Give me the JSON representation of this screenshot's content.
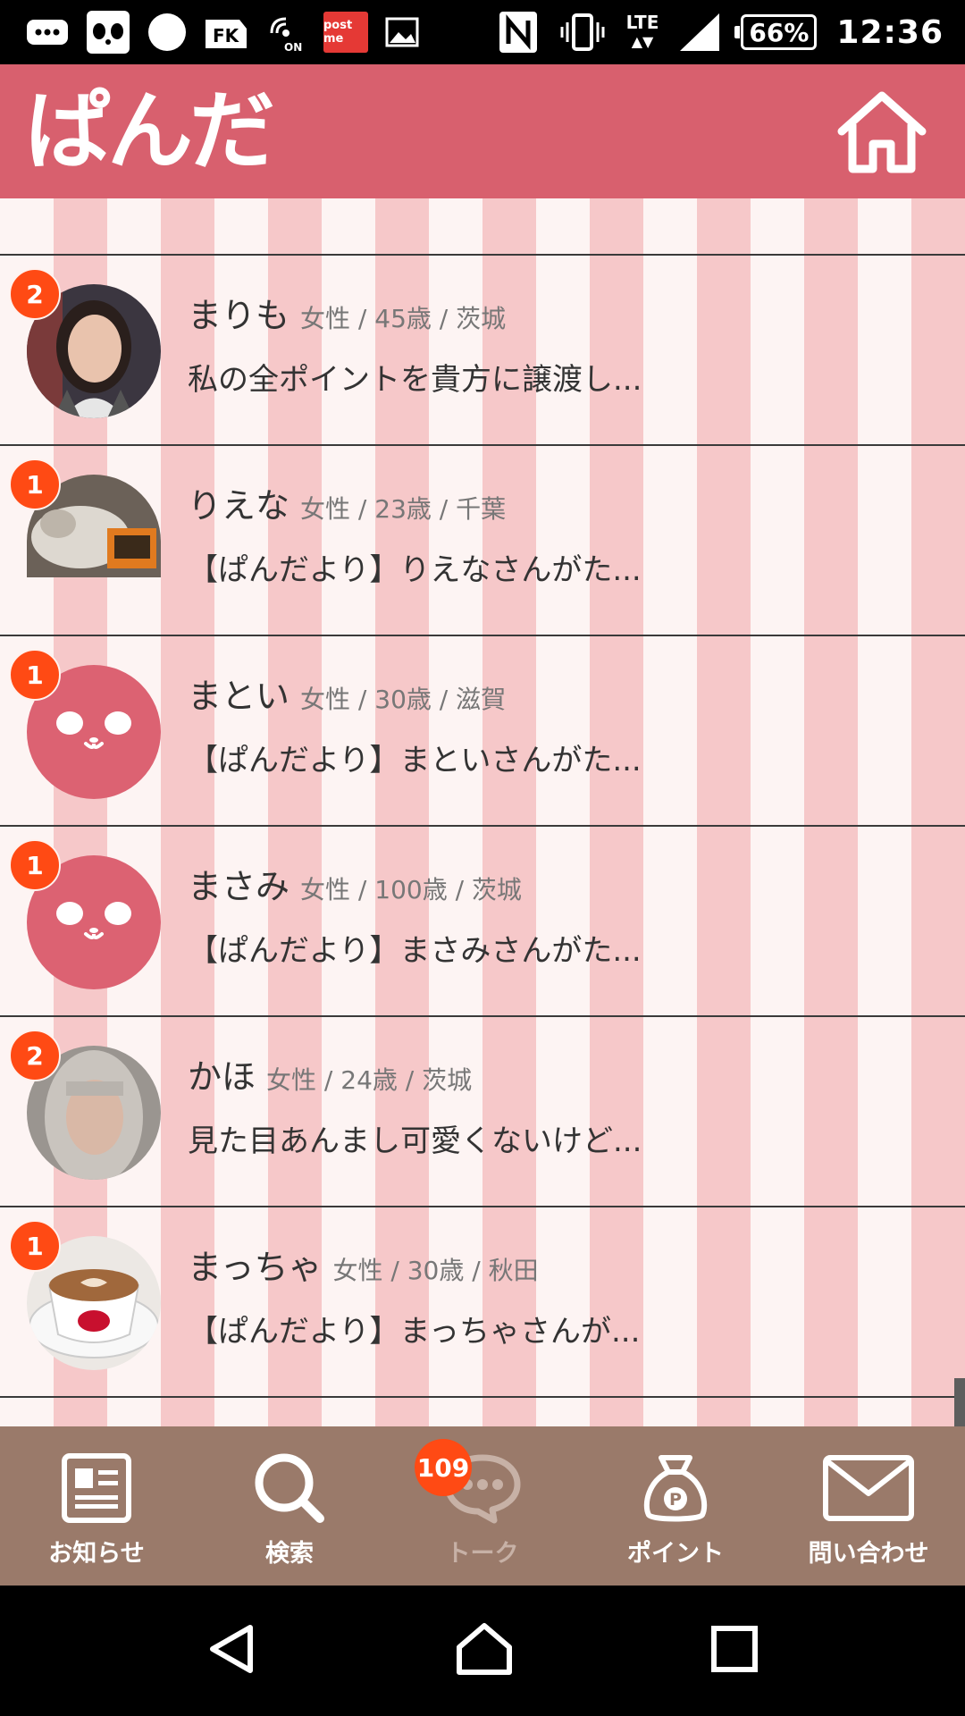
{
  "status_bar": {
    "postme_label": "post me",
    "network": "LTE",
    "battery": "66%",
    "time": "12:36"
  },
  "header": {
    "logo": "ぱんだ",
    "home_icon": "home-icon"
  },
  "messages": [
    {
      "badge": "2",
      "name": "まりも",
      "meta": "女性 / 45歳 / 茨城",
      "preview": "私の全ポイントを貴方に譲渡し...",
      "avatar": "photo-woman"
    },
    {
      "badge": "1",
      "name": "りえな",
      "meta": "女性 / 23歳 / 千葉",
      "preview": "【ぱんだより】りえなさんがた...",
      "avatar": "photo-cat"
    },
    {
      "badge": "1",
      "name": "まとい",
      "meta": "女性 / 30歳 / 滋賀",
      "preview": "【ぱんだより】まといさんがた...",
      "avatar": "panda"
    },
    {
      "badge": "1",
      "name": "まさみ",
      "meta": "女性 / 100歳 / 茨城",
      "preview": "【ぱんだより】まさみさんがた...",
      "avatar": "panda"
    },
    {
      "badge": "2",
      "name": "かほ",
      "meta": "女性 / 24歳 / 茨城",
      "preview": "見た目あんまし可愛くないけど...",
      "avatar": "photo-face"
    },
    {
      "badge": "1",
      "name": "まっちゃ",
      "meta": "女性 / 30歳 / 秋田",
      "preview": "【ぱんだより】まっちゃさんが...",
      "avatar": "photo-coffee"
    }
  ],
  "bottom_nav": {
    "items": [
      {
        "label": "お知らせ",
        "icon": "news-icon"
      },
      {
        "label": "検索",
        "icon": "search-icon"
      },
      {
        "label": "トーク",
        "icon": "chat-icon",
        "badge": "109"
      },
      {
        "label": "ポイント",
        "icon": "point-bag-icon"
      },
      {
        "label": "問い合わせ",
        "icon": "mail-icon"
      }
    ]
  },
  "colors": {
    "header": "#d8606e",
    "stripe_light": "#fdf4f3",
    "stripe_pink": "#f6c8c9",
    "badge": "#ff4a14",
    "nav_bg": "#9a7a6a"
  }
}
